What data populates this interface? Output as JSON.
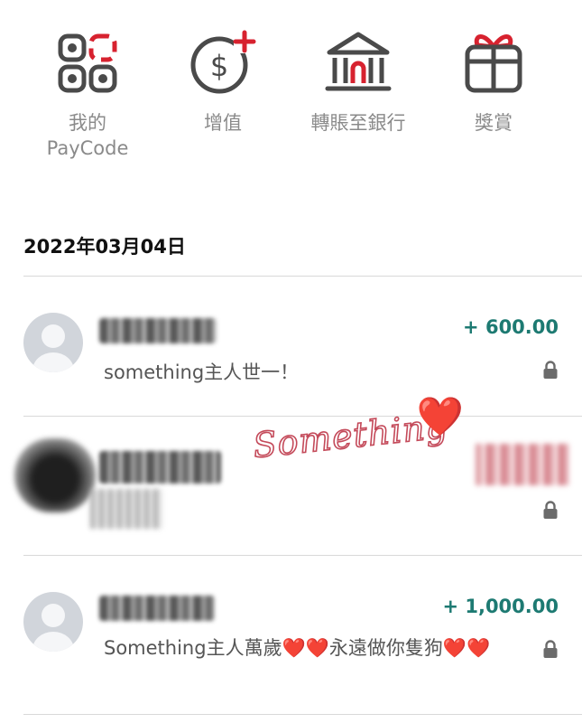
{
  "actions": [
    {
      "label_line1": "我的",
      "label_line2": "PayCode",
      "icon": "paycode-icon"
    },
    {
      "label_line1": "增值",
      "label_line2": "",
      "icon": "top-up-icon"
    },
    {
      "label_line1": "轉賬至銀行",
      "label_line2": "",
      "icon": "bank-icon"
    },
    {
      "label_line1": "獎賞",
      "label_line2": "",
      "icon": "gift-icon"
    }
  ],
  "date_heading": "2022年03月04日",
  "transactions": [
    {
      "amount": "+ 600.00",
      "note": "something主人世一！",
      "locked": true
    },
    {
      "amount": "",
      "note": "",
      "locked": true
    },
    {
      "amount": "+ 1,000.00",
      "note": "Something主人萬歲❤️❤️永遠做你隻狗❤️❤️",
      "locked": true
    }
  ],
  "sticker": {
    "text": "Something",
    "emoji": "❤️"
  },
  "colors": {
    "accent_red": "#d7222f",
    "icon_gray": "#4a4a4a",
    "amount_teal": "#1d7a72",
    "label_gray": "#8a8a8a"
  }
}
